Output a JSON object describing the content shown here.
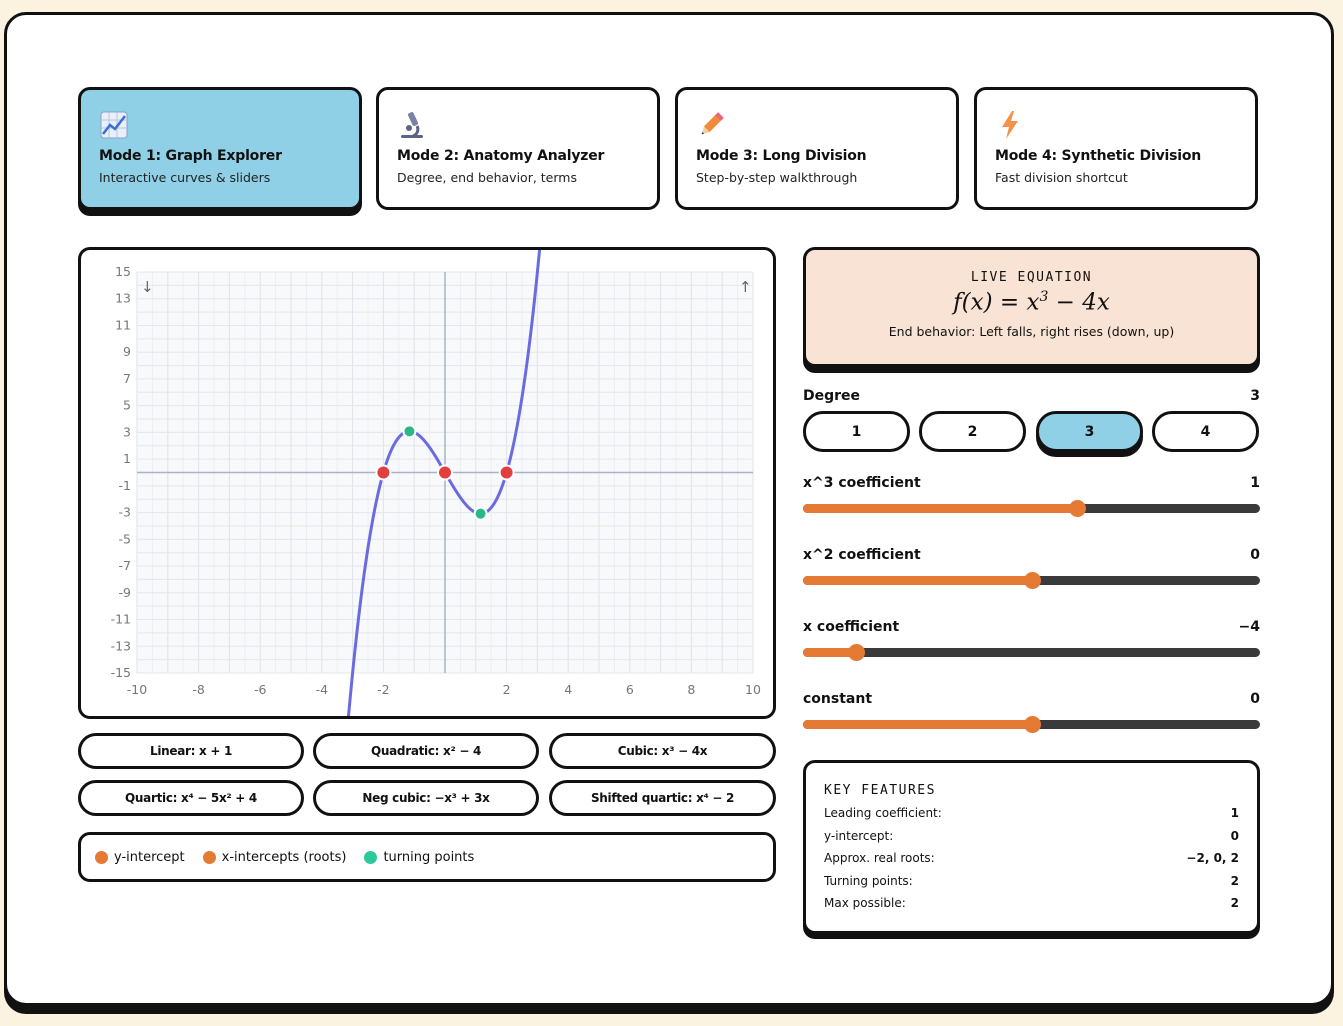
{
  "modes": [
    {
      "icon": "chart-icon",
      "title": "Mode 1: Graph Explorer",
      "subtitle": "Interactive curves & sliders",
      "active": true
    },
    {
      "icon": "microscope-icon",
      "title": "Mode 2: Anatomy Analyzer",
      "subtitle": "Degree, end behavior, terms",
      "active": false
    },
    {
      "icon": "pencil-icon",
      "title": "Mode 3: Long Division",
      "subtitle": "Step-by-step walkthrough",
      "active": false
    },
    {
      "icon": "lightning-icon",
      "title": "Mode 4: Synthetic Division",
      "subtitle": "Fast division shortcut",
      "active": false
    }
  ],
  "graph": {
    "x_ticks": [
      "-10",
      "-8",
      "-6",
      "-4",
      "-2",
      "2",
      "4",
      "6",
      "8",
      "10"
    ],
    "y_ticks": [
      "15",
      "13",
      "11",
      "9",
      "7",
      "5",
      "3",
      "1",
      "-1",
      "-3",
      "-5",
      "-7",
      "-9",
      "-11",
      "-13",
      "-15"
    ],
    "left_arrow": "↓",
    "right_arrow": "↑",
    "xlim": [
      -10,
      10
    ],
    "ylim": [
      -15,
      15
    ],
    "coefficients": {
      "a3": 1,
      "a2": 0,
      "a1": -4,
      "a0": 0
    },
    "roots": [
      -2,
      0,
      2
    ],
    "turning_points": [
      [
        -1.155,
        3.08
      ],
      [
        1.155,
        -3.08
      ]
    ],
    "curve_color": "#6b6be0",
    "root_color": "#e2403e",
    "turning_color": "#2ab889"
  },
  "presets": [
    "Linear: x + 1",
    "Quadratic: x² − 4",
    "Cubic: x³ − 4x",
    "Quartic: x⁴ − 5x² + 4",
    "Neg cubic: −x³ + 3x",
    "Shifted quartic: x⁴ − 2"
  ],
  "legend": {
    "y_intercept": "y-intercept",
    "x_intercepts": "x-intercepts (roots)",
    "turning": "turning points",
    "orange": "#e47a34",
    "teal": "#2ec99a"
  },
  "equation": {
    "label": "LIVE EQUATION",
    "lhs": "f(x) = x",
    "exp": "3",
    "rhs": " − 4x",
    "end_behavior": "End behavior: Left falls, right rises (down, up)"
  },
  "degree": {
    "label": "Degree",
    "value": "3",
    "options": [
      "1",
      "2",
      "3",
      "4"
    ],
    "selected": "3"
  },
  "sliders": [
    {
      "label": "x^3 coefficient",
      "value": "1",
      "fraction": 0.6
    },
    {
      "label": "x^2 coefficient",
      "value": "0",
      "fraction": 0.5
    },
    {
      "label": "x coefficient",
      "value": "−4",
      "fraction": 0.115
    },
    {
      "label": "constant",
      "value": "0",
      "fraction": 0.5
    }
  ],
  "key_features": {
    "label": "KEY FEATURES",
    "rows": [
      {
        "label": "Leading coefficient:",
        "value": "1"
      },
      {
        "label": "y-intercept:",
        "value": "0"
      },
      {
        "label": "Approx. real roots:",
        "value": "−2, 0, 2"
      },
      {
        "label": "Turning points:",
        "value": "2"
      },
      {
        "label": "Max possible:",
        "value": "2"
      }
    ]
  }
}
